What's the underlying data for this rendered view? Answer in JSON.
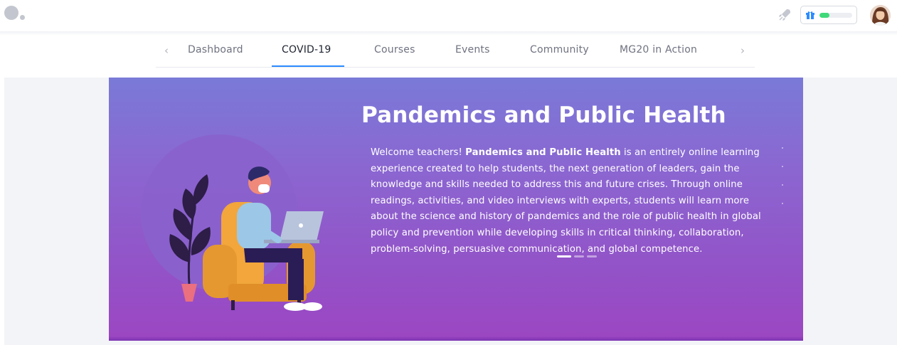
{
  "header": {
    "logo": "app-logo",
    "rocket_icon": "rocket-icon",
    "xp": {
      "icon": "gift-icon",
      "progress": 0.3,
      "fill_color": "#3fd97a"
    },
    "avatar": "user-avatar"
  },
  "nav": {
    "prev_label": "‹",
    "next_label": "›",
    "tabs": [
      {
        "label": "Dashboard"
      },
      {
        "label": "COVID-19",
        "active": true
      },
      {
        "label": "Courses"
      },
      {
        "label": "Events"
      },
      {
        "label": "Community"
      },
      {
        "label": "MG20 in Action"
      }
    ],
    "accent_color": "#2d8cff"
  },
  "hero": {
    "title": "Pandemics and Public Health",
    "body_intro": "Welcome teachers! ",
    "body_bold": "Pandemics and Public Health",
    "body_rest": " is an entirely online learning experience created to help students, the next generation of leaders, gain the knowledge and skills needed to address this and future crises. Through online readings, activities, and video interviews with experts, students will learn more about the science and history of pandemics and the role of public health in global policy and prevention while developing skills in critical thinking, collaboration, problem-solving, persuasive communication, and global competence.",
    "slides": 3,
    "active_slide": 0,
    "illustration": "person-with-mask-on-laptop-illustration",
    "gradient": [
      "#7a7ad8",
      "#9c46c2"
    ]
  }
}
